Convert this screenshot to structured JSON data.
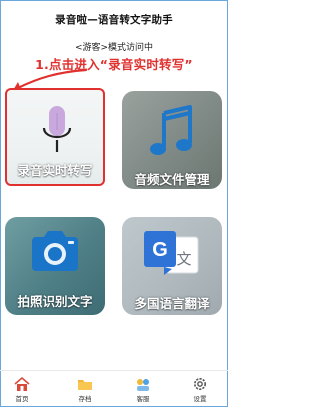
{
  "header": {
    "app_title": "录音啦—语音转文字助手",
    "mode_text": "<游客>模式访问中",
    "guide_text": "1.点击进入“录音实时转写”"
  },
  "tiles": [
    {
      "label": "录音实时转写",
      "icon": "microphone-icon"
    },
    {
      "label": "音频文件管理",
      "icon": "music-note-icon"
    },
    {
      "label": "拍照识别文字",
      "icon": "camera-icon"
    },
    {
      "label": "多国语言翻译",
      "icon": "translate-icon"
    }
  ],
  "bottom_nav": {
    "items": [
      {
        "label": "首页",
        "icon": "home-icon"
      },
      {
        "label": "存档",
        "icon": "archive-icon"
      },
      {
        "label": "客服",
        "icon": "customer-service-icon"
      },
      {
        "label": "设置",
        "icon": "gear-icon"
      }
    ]
  },
  "colors": {
    "accent_red": "#e0312f",
    "frame_blue": "#6aa7dc",
    "mic_purple": "#c9a8dd",
    "note_blue": "#1e77c8",
    "camera_blue": "#1a74c7",
    "translate_blue": "#2f73d6"
  }
}
